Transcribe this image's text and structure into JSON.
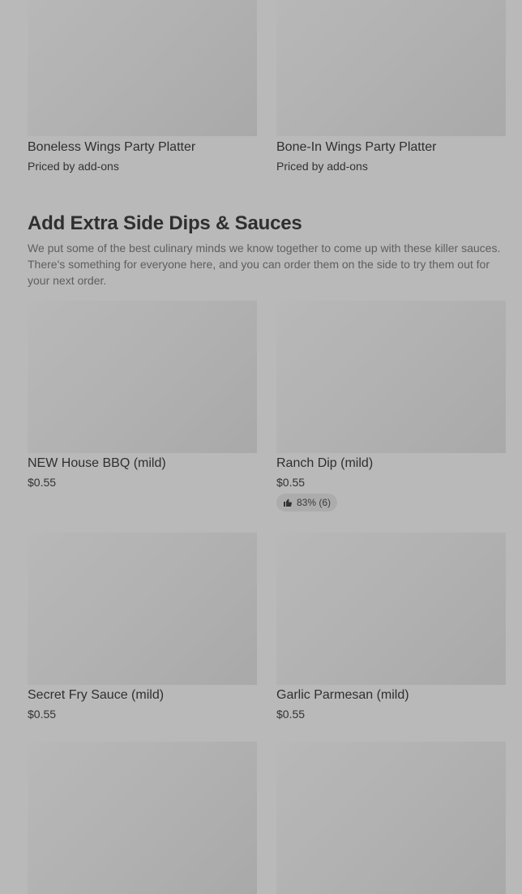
{
  "platters": [
    {
      "name": "Boneless Wings Party Platter",
      "price": "Priced by add-ons"
    },
    {
      "name": "Bone-In Wings Party Platter",
      "price": "Priced by add-ons"
    }
  ],
  "section": {
    "title": "Add Extra Side Dips & Sauces",
    "description": "We put some of the best culinary minds we know together to come up with these killer sauces. There's something for everyone here, and you can order them on the side to try them out for your next order."
  },
  "items": [
    {
      "name": "NEW House BBQ (mild)",
      "price": "$0.55"
    },
    {
      "name": "Ranch Dip (mild)",
      "price": "$0.55",
      "rating": "83% (6)"
    },
    {
      "name": "Secret Fry Sauce (mild)",
      "price": "$0.55"
    },
    {
      "name": "Garlic Parmesan (mild)",
      "price": "$0.55"
    }
  ],
  "icons": {
    "rating_icon": "thumbs-up-icon"
  }
}
